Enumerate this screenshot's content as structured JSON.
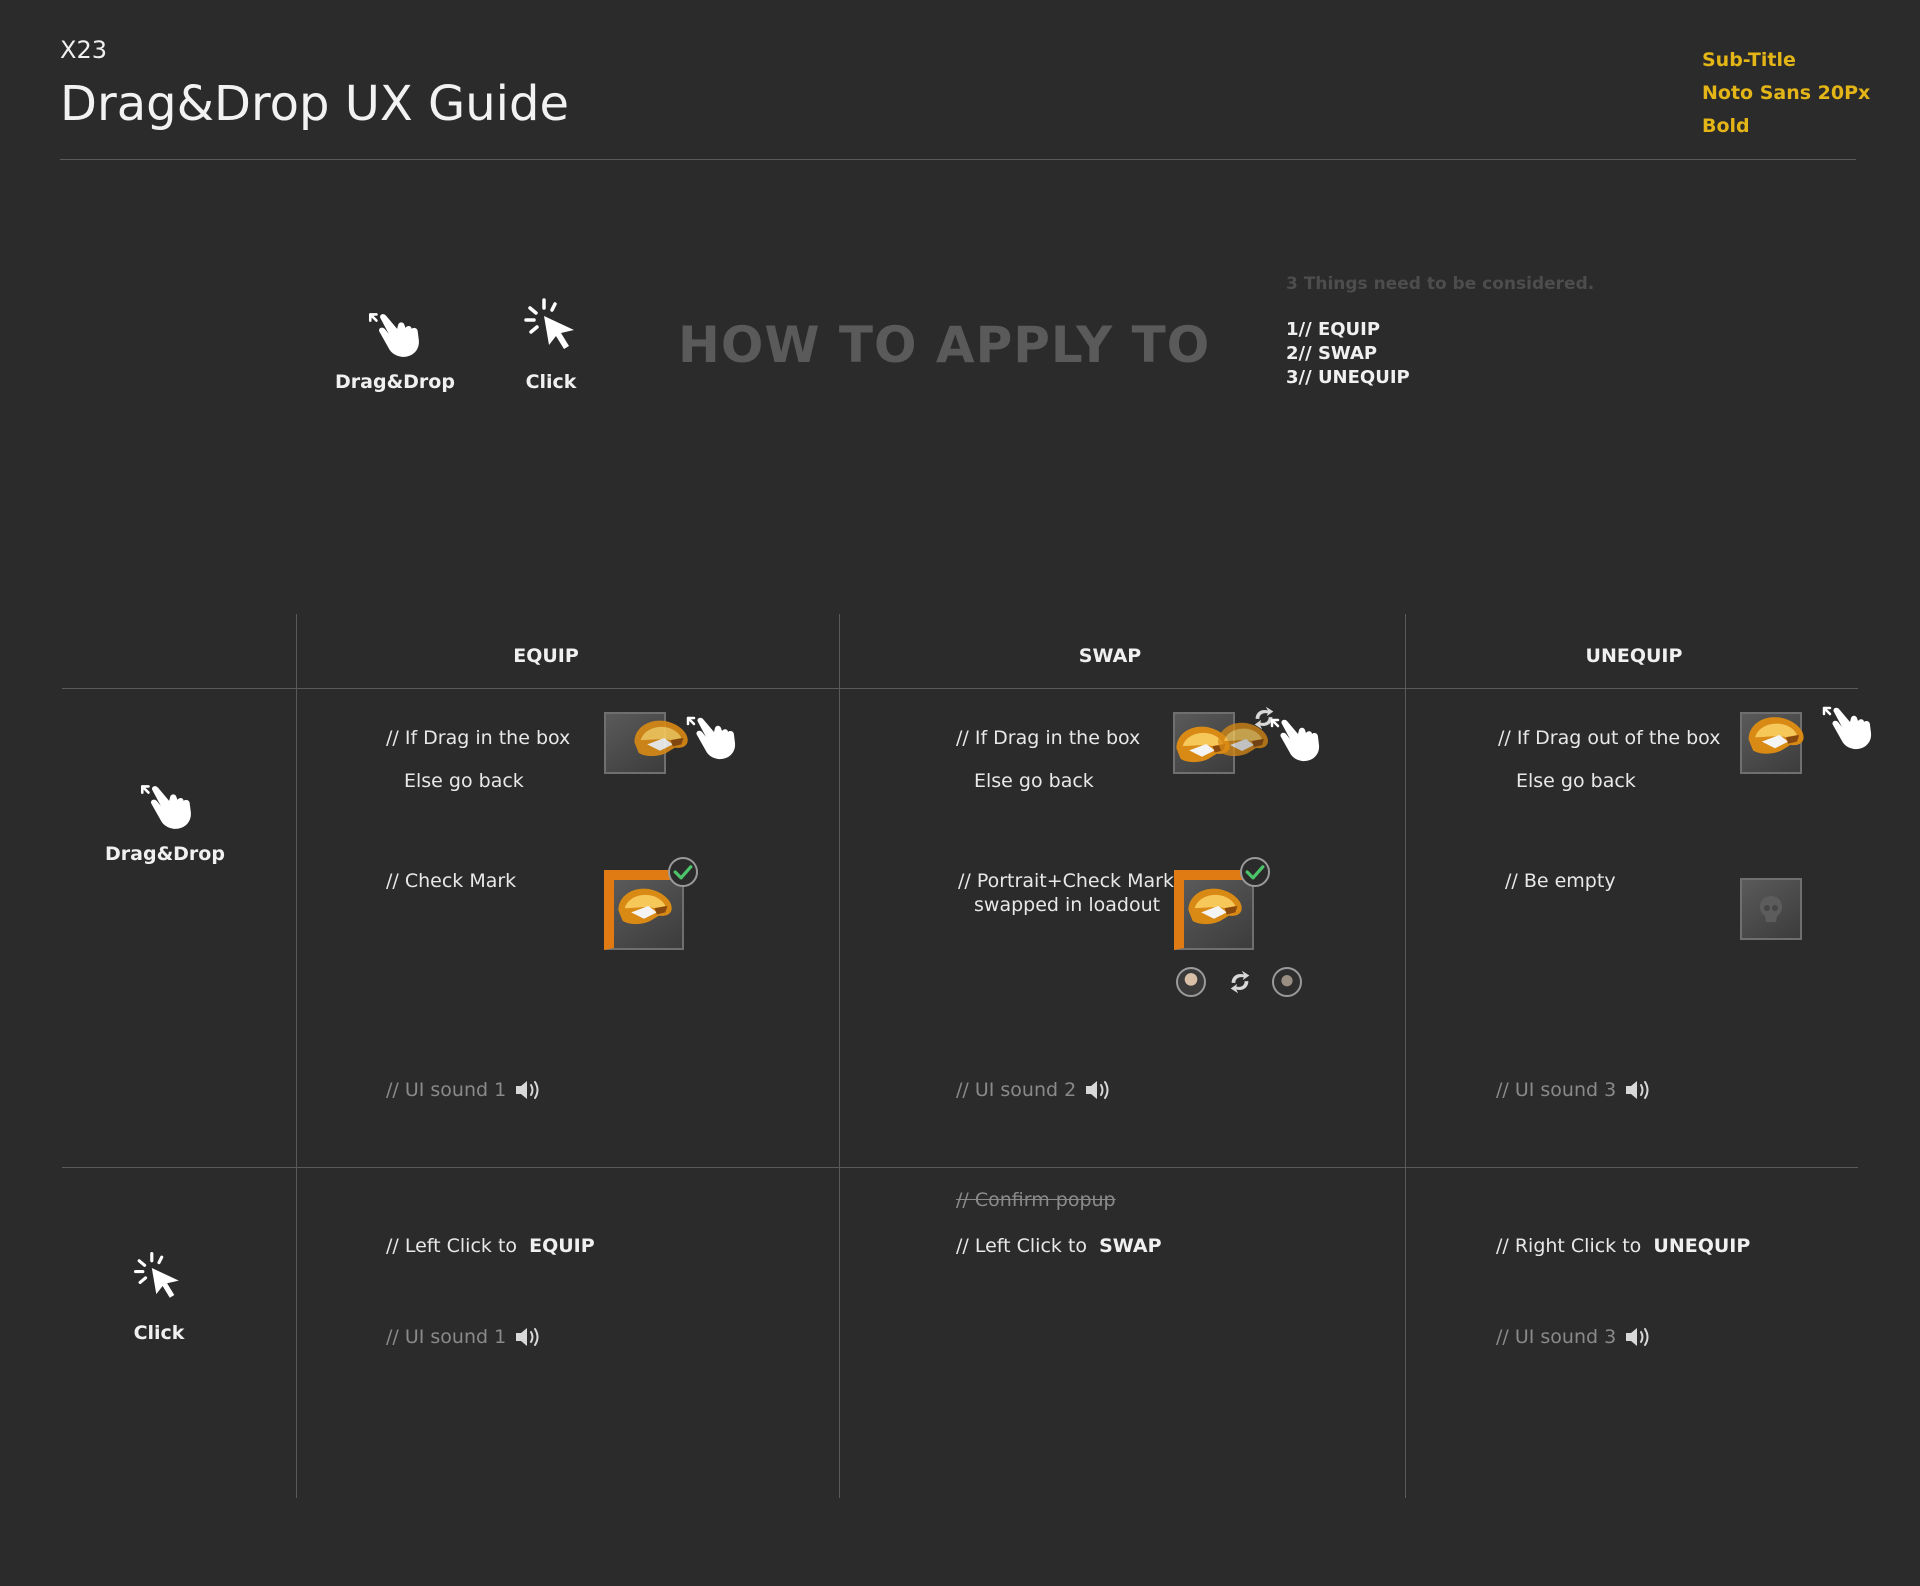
{
  "header": {
    "kicker": "X23",
    "title": "Drag&Drop UX Guide",
    "spec_lines": [
      "Sub-Title",
      "Noto Sans 20Px",
      "Bold"
    ]
  },
  "intro": {
    "drag_label": "Drag&Drop",
    "click_label": "Click",
    "heading": "HOW TO APPLY TO",
    "considered": "3 Things need to be considered.",
    "steps": [
      "1// EQUIP",
      "2// SWAP",
      "3// UNEQUIP"
    ]
  },
  "table": {
    "columns": [
      "EQUIP",
      "SWAP",
      "UNEQUIP"
    ],
    "rows": {
      "drag_label": "Drag&Drop",
      "click_label": "Click"
    },
    "drag": {
      "equip": {
        "line1": "// If Drag in the box",
        "line2": "Else go back",
        "line3": "// Check Mark",
        "sound": "// UI sound 1"
      },
      "swap": {
        "line1": "// If Drag in the box",
        "line2": "Else go back",
        "line3a": "// Portrait+Check Mark",
        "line3b": "swapped in loadout",
        "sound": "// UI sound 2"
      },
      "unequip": {
        "line1": "// If Drag out of the box",
        "line2": "Else go back",
        "line3": "// Be empty",
        "sound": "// UI sound 3"
      }
    },
    "click": {
      "equip": {
        "prefix": "// Left Click to",
        "action": "EQUIP",
        "sound": "// UI sound 1"
      },
      "swap": {
        "struck": "// Confirm popup",
        "prefix": "// Left Click to",
        "action": "SWAP"
      },
      "unequip": {
        "prefix": "// Right Click to",
        "action": "UNEQUIP",
        "sound": "// UI sound 3"
      }
    }
  },
  "colors": {
    "background": "#2b2b2b",
    "accent": "#e4b516",
    "check": "#4cc46a",
    "item_orange": "#e07a12"
  },
  "icons": [
    "hand-pointer-icon",
    "click-cursor-icon",
    "speaker-icon",
    "check-icon",
    "swap-arrows-icon",
    "helmet-item-icon",
    "skull-placeholder-icon"
  ]
}
